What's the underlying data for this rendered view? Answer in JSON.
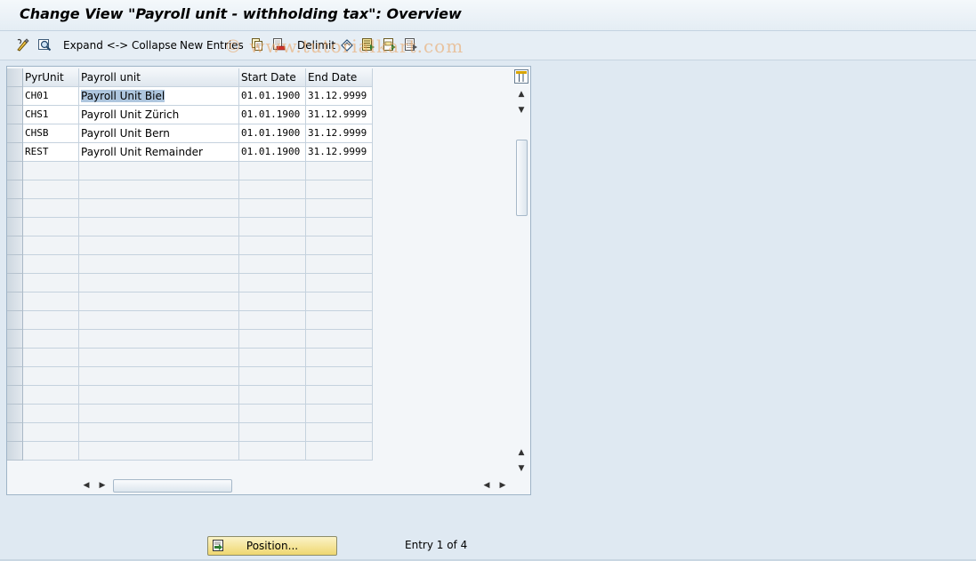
{
  "window": {
    "title": "Change View \"Payroll unit - withholding tax\": Overview"
  },
  "toolbar": {
    "expand_label": "Expand <-> Collapse",
    "new_entries_label": "New Entries",
    "delimit_label": "Delimit"
  },
  "watermark": "© www.tutorialkart.com",
  "table": {
    "columns": [
      "PyrUnit",
      "Payroll unit",
      "Start Date",
      "End Date"
    ],
    "rows": [
      {
        "pyrunit": "CH01",
        "name": "Payroll Unit Biel",
        "start": "01.01.1900",
        "end": "31.12.9999"
      },
      {
        "pyrunit": "CHS1",
        "name": "Payroll Unit Zürich",
        "start": "01.01.1900",
        "end": "31.12.9999"
      },
      {
        "pyrunit": "CHSB",
        "name": "Payroll Unit Bern",
        "start": "01.01.1900",
        "end": "31.12.9999"
      },
      {
        "pyrunit": "REST",
        "name": "Payroll Unit Remainder",
        "start": "01.01.1900",
        "end": "31.12.9999"
      }
    ]
  },
  "footer": {
    "position_label": "Position...",
    "entry_label": "Entry 1 of 4"
  },
  "colors": {
    "position_button": "#efd770",
    "selection": "#aec6de"
  }
}
